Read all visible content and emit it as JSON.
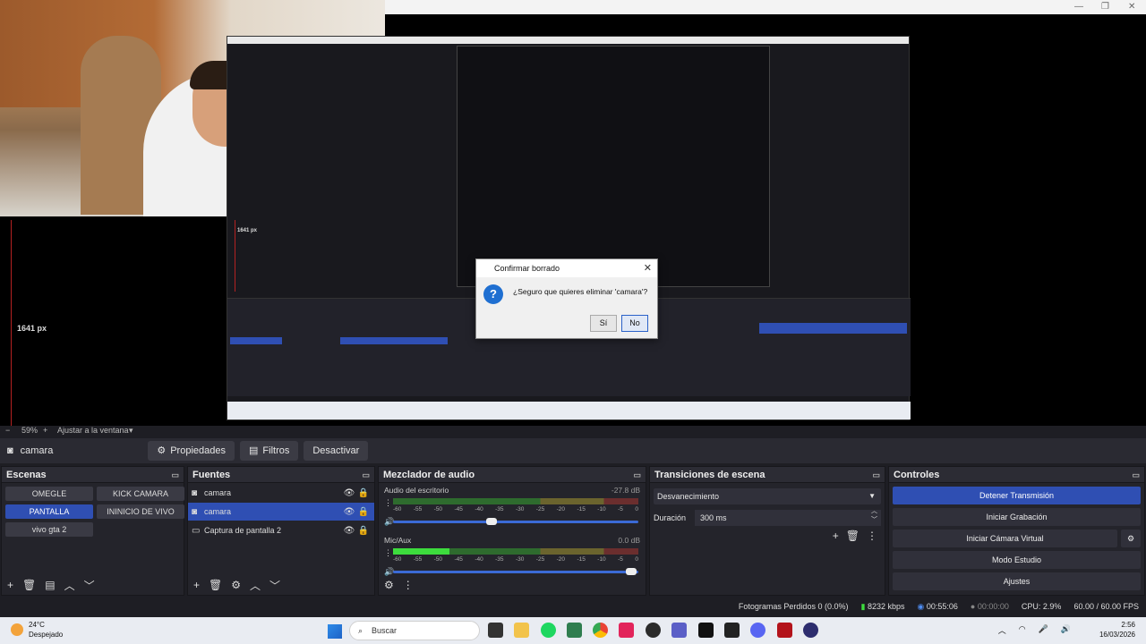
{
  "preview": {
    "px_label": "1641 px",
    "nested_px_label": "1641 px",
    "zoom_value": "59%",
    "zoom_mode": "Ajustar a la ventana"
  },
  "dialog": {
    "title": "Confirmar borrado",
    "message": "¿Seguro que quieres eliminar 'camara'?",
    "yes": "Sí",
    "no": "No"
  },
  "source_bar": {
    "source_name": "camara",
    "properties": "Propiedades",
    "filters": "Filtros",
    "deactivate": "Desactivar"
  },
  "scenes": {
    "title": "Escenas",
    "items": [
      {
        "label": "OMEGLE",
        "active": false
      },
      {
        "label": "KICK CAMARA",
        "active": false
      },
      {
        "label": "PANTALLA",
        "active": true
      },
      {
        "label": "ININICIO DE VIVO",
        "active": false
      },
      {
        "label": "vivo gta 2",
        "active": false
      }
    ]
  },
  "sources": {
    "title": "Fuentes",
    "items": [
      {
        "label": "camara",
        "icon": "camera-icon",
        "active": false
      },
      {
        "label": "camara",
        "icon": "camera-icon",
        "active": true
      },
      {
        "label": "Captura de pantalla 2",
        "icon": "monitor-icon",
        "active": false
      }
    ]
  },
  "mixer": {
    "title": "Mezclador de audio",
    "channels": [
      {
        "name": "Audio del escritorio",
        "db": "-27.8 dB",
        "level": 0,
        "volume": 0.4
      },
      {
        "name": "Mic/Aux",
        "db": "0.0 dB",
        "level": 0.23,
        "volume": 0.97
      }
    ],
    "ticks": [
      "-60",
      "-55",
      "-50",
      "-45",
      "-40",
      "-35",
      "-30",
      "-25",
      "-20",
      "-15",
      "-10",
      "-5",
      "0"
    ]
  },
  "transitions": {
    "title": "Transiciones de escena",
    "selected": "Desvanecimiento",
    "duration_label": "Duración",
    "duration_value": "300 ms"
  },
  "controls": {
    "title": "Controles",
    "buttons": [
      {
        "label": "Detener Transmisión",
        "active": true
      },
      {
        "label": "Iniciar Grabación",
        "active": false
      },
      {
        "label": "Iniciar Cámara Virtual",
        "active": false
      },
      {
        "label": "Modo Estudio",
        "active": false
      },
      {
        "label": "Ajustes",
        "active": false
      }
    ]
  },
  "status": {
    "dropped": "Fotogramas Perdidos 0 (0.0%)",
    "bitrate": "8232 kbps",
    "stream_time": "00:55:06",
    "rec_time": "00:00:00",
    "cpu": "CPU: 2.9%",
    "fps": "60.00 / 60.00 FPS"
  },
  "taskbar": {
    "temp": "24°C",
    "weather": "Despejado",
    "search": "Buscar",
    "time": "2:56",
    "date": "16/03/2026"
  }
}
